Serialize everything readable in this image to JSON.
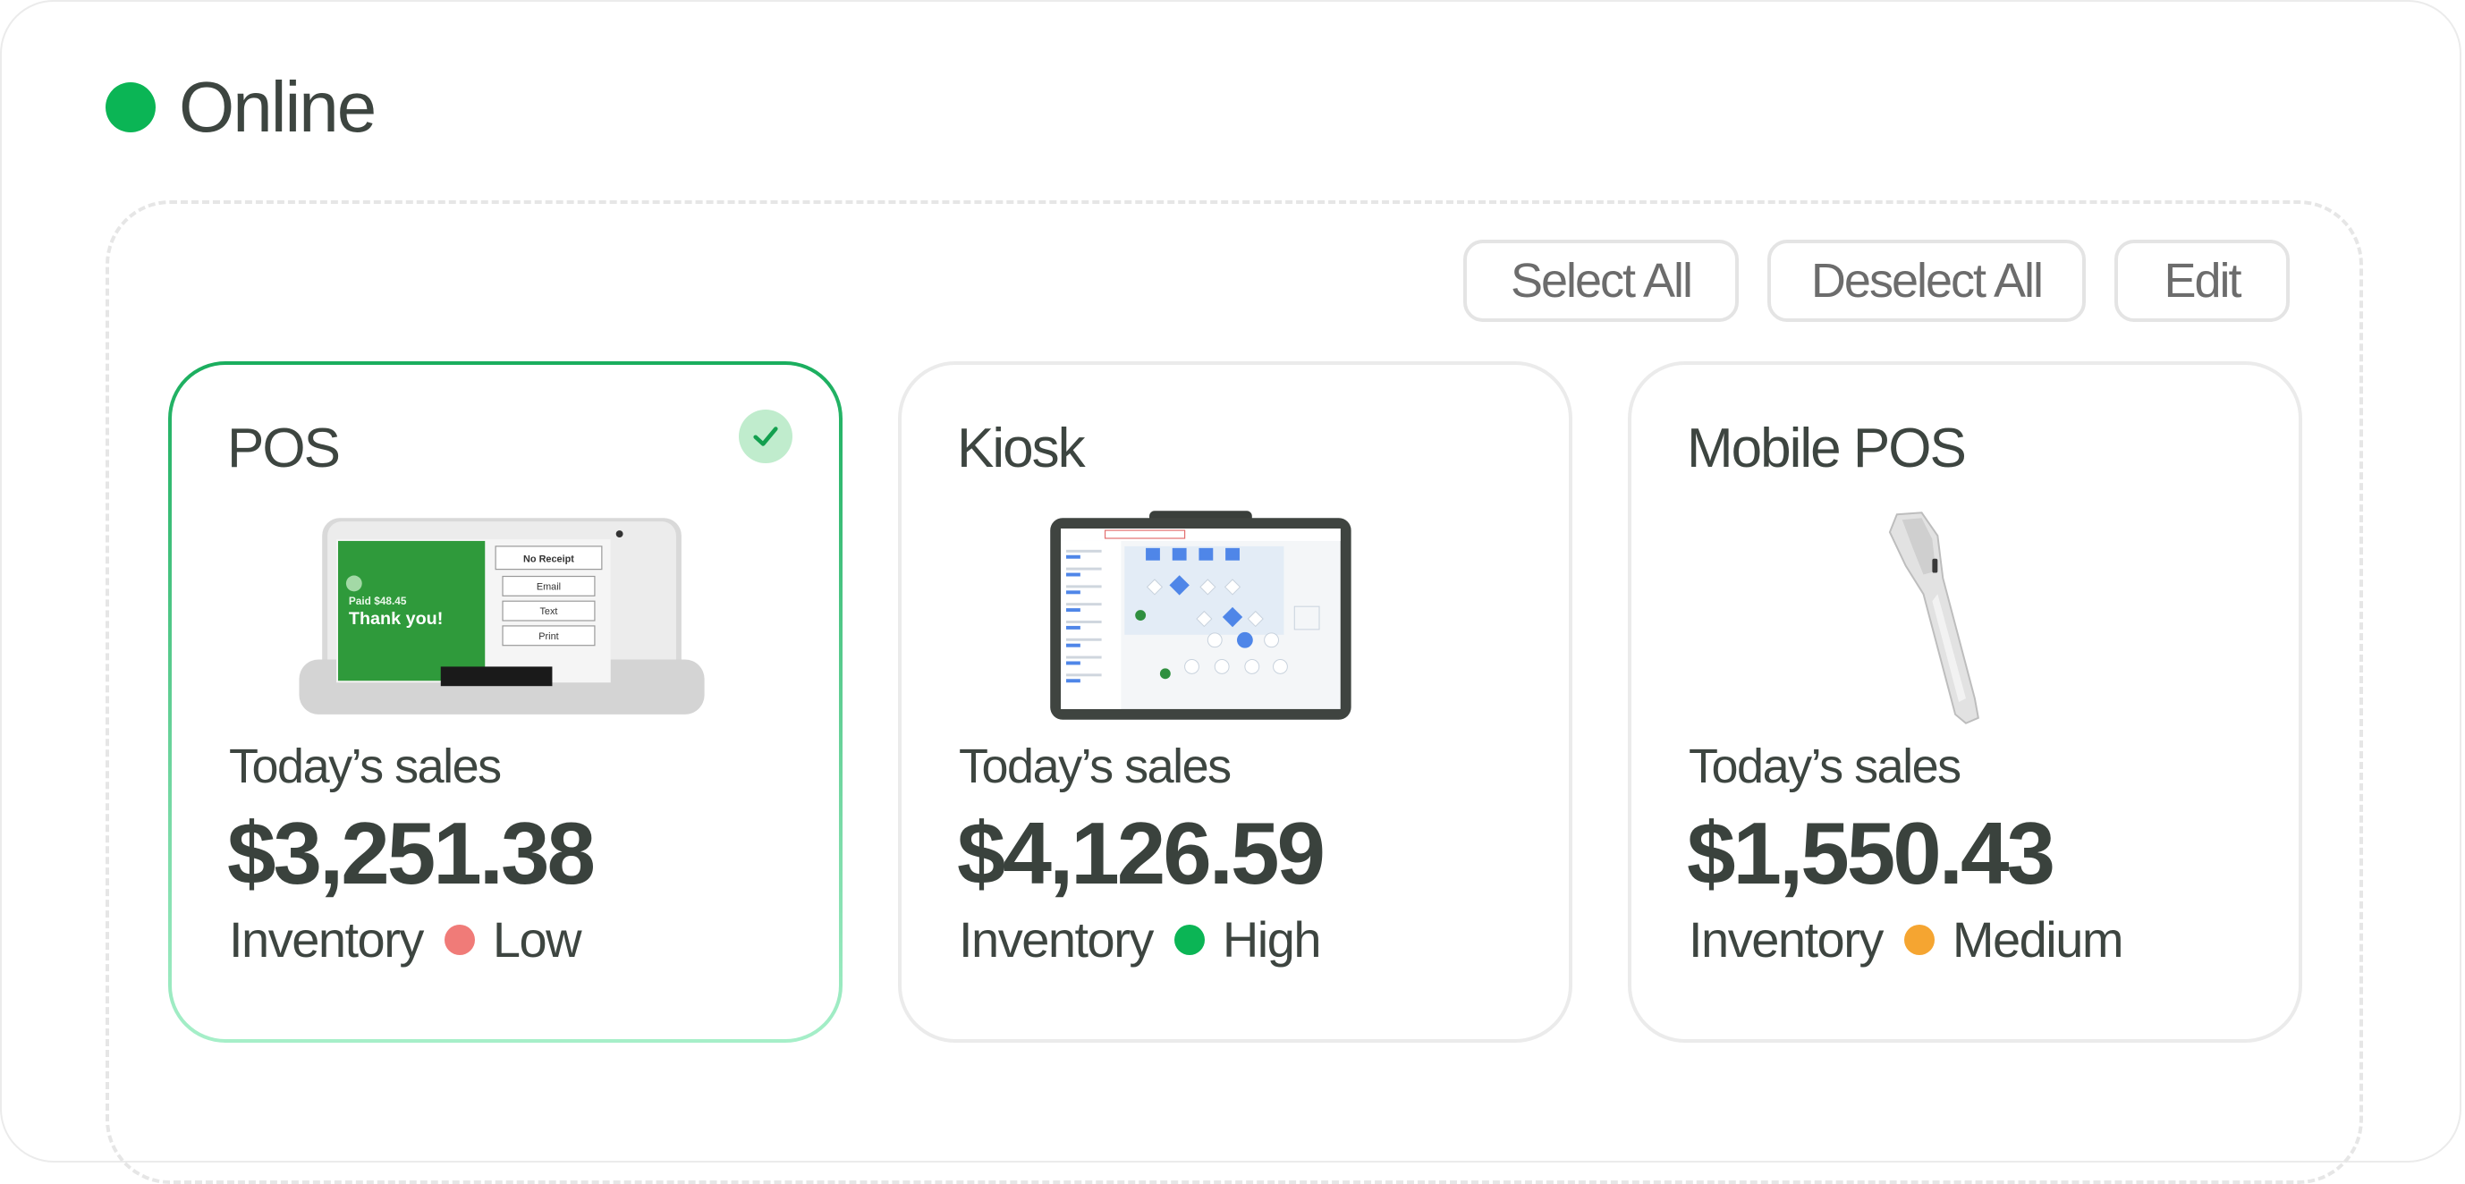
{
  "status": {
    "label": "Online",
    "color": "#0bb555"
  },
  "toolbar": {
    "select_all": "Select All",
    "deselect_all": "Deselect All",
    "edit": "Edit"
  },
  "devices": [
    {
      "name": "POS",
      "selected": true,
      "sales_label": "Today’s sales",
      "sales": "$3,251.38",
      "inventory_label": "Inventory",
      "inventory_level": "Low",
      "inventory_color": "#f07b78",
      "screen_text_top": "Paid $48.45",
      "screen_text_main": "Thank you!",
      "screen_buttons": [
        "No Receipt",
        "Email",
        "Text",
        "Print"
      ]
    },
    {
      "name": "Kiosk",
      "selected": false,
      "sales_label": "Today’s sales",
      "sales": "$4,126.59",
      "inventory_label": "Inventory",
      "inventory_level": "High",
      "inventory_color": "#0bb555"
    },
    {
      "name": "Mobile POS",
      "selected": false,
      "sales_label": "Today’s sales",
      "sales": "$1,550.43",
      "inventory_label": "Inventory",
      "inventory_level": "Medium",
      "inventory_color": "#f5a531"
    }
  ]
}
